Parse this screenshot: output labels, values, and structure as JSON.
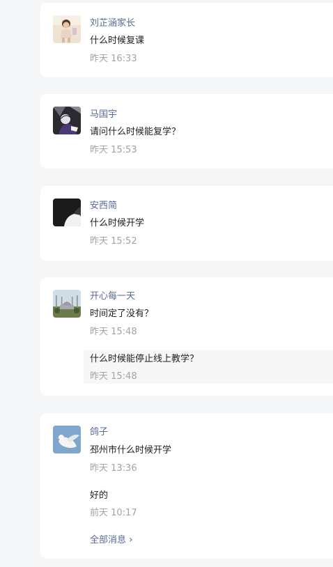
{
  "threads": [
    {
      "name": "刘芷涵家长",
      "avatar_icon": "child-photo-icon",
      "messages": [
        {
          "text": "什么时候复课",
          "time": "昨天 16:33"
        }
      ]
    },
    {
      "name": "马国宇",
      "avatar_icon": "person-photo-icon",
      "messages": [
        {
          "text": "请问什么时候能复学？",
          "time": "昨天 15:53"
        }
      ]
    },
    {
      "name": "安西简",
      "avatar_icon": "abstract-photo-icon",
      "messages": [
        {
          "text": "什么时候开学",
          "time": "昨天 15:52"
        }
      ]
    },
    {
      "name": "开心每一天",
      "avatar_icon": "mosque-photo-icon",
      "messages": [
        {
          "text": "时间定了没有？",
          "time": "昨天 15:48"
        },
        {
          "text": "什么时候能停止线上教学？",
          "time": "昨天 15:48"
        }
      ]
    },
    {
      "name": "鸽子",
      "avatar_icon": "dove-photo-icon",
      "messages": [
        {
          "text": "邳州市什么时候开学",
          "time": "昨天 13:36"
        },
        {
          "text": "好的",
          "time": "前天 10:17"
        }
      ],
      "all_messages_label": "全部消息"
    }
  ],
  "colors": {
    "background": "#f5f6f7",
    "name": "#576b95",
    "time": "#a3a3a3",
    "text": "#1f1f1f"
  }
}
